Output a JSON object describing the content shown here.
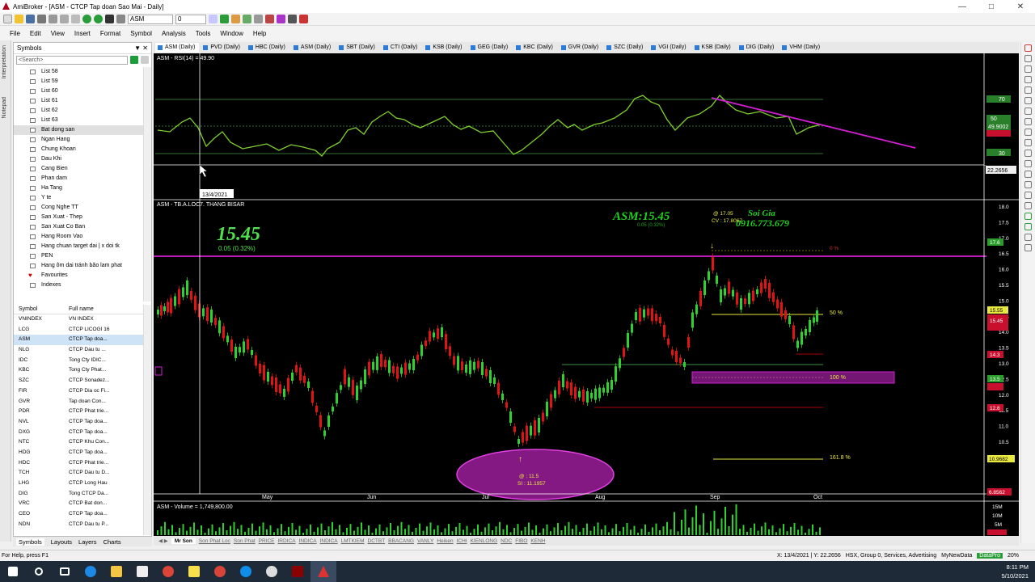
{
  "window": {
    "title": "AmiBroker - [ASM - CTCP Tap doan Sao Mai - Daily]"
  },
  "toolbar": {
    "symbol": "ASM",
    "value": "0"
  },
  "menu": [
    "File",
    "Edit",
    "View",
    "Insert",
    "Format",
    "Symbol",
    "Analysis",
    "Tools",
    "Window",
    "Help"
  ],
  "left_tabs": [
    "Interpretation",
    "Notepad"
  ],
  "symbols_panel": {
    "title": "Symbols",
    "search_placeholder": "<Search>",
    "tree": [
      {
        "label": "List 58"
      },
      {
        "label": "List 59"
      },
      {
        "label": "List 60"
      },
      {
        "label": "List 61"
      },
      {
        "label": "List 62"
      },
      {
        "label": "List 63"
      },
      {
        "label": "Bat dong san",
        "selected": true
      },
      {
        "label": "Ngan Hang"
      },
      {
        "label": "Chung Khoan"
      },
      {
        "label": "Dau Khi"
      },
      {
        "label": "Cang Bien"
      },
      {
        "label": "Phan dam"
      },
      {
        "label": "Ha Tang"
      },
      {
        "label": "Y te"
      },
      {
        "label": "Cong Nghe TT"
      },
      {
        "label": "San Xuat - Thep"
      },
      {
        "label": "San Xuat Co Ban"
      },
      {
        "label": "Hang Room Vao"
      },
      {
        "label": "Hang chuan target dai | x doi tk"
      },
      {
        "label": "PEN"
      },
      {
        "label": "Hang ôm dai tránh bão lam phat"
      },
      {
        "label": "Favourites",
        "heart": true
      },
      {
        "label": "Indexes"
      }
    ],
    "col_symbol": "Symbol",
    "col_fullname": "Full name",
    "rows": [
      {
        "s": "VNINDEX",
        "n": "VN INDEX"
      },
      {
        "s": "LCG",
        "n": "CTCP LICOGI 16"
      },
      {
        "s": "ASM",
        "n": "CTCP Tap doa...",
        "selected": true
      },
      {
        "s": "NLG",
        "n": "CTCP Dau tu ..."
      },
      {
        "s": "IDC",
        "n": "Tong Cty IDIC..."
      },
      {
        "s": "KBC",
        "n": "Tong Cty Phat..."
      },
      {
        "s": "SZC",
        "n": "CTCP Sonadez..."
      },
      {
        "s": "FIR",
        "n": "CTCP Dia oc Fi..."
      },
      {
        "s": "GVR",
        "n": "Tap  doan Con..."
      },
      {
        "s": "PDR",
        "n": "CTCP Phat trie..."
      },
      {
        "s": "NVL",
        "n": "CTCP Tap doa..."
      },
      {
        "s": "DXG",
        "n": "CTCP Tap doa..."
      },
      {
        "s": "NTC",
        "n": "CTCP Khu Con..."
      },
      {
        "s": "HDG",
        "n": "CTCP Tap doa..."
      },
      {
        "s": "HDC",
        "n": "CTCP Phat trie..."
      },
      {
        "s": "TCH",
        "n": "CTCP Dau tu D..."
      },
      {
        "s": "LHG",
        "n": "CTCP Long Hau"
      },
      {
        "s": "DIG",
        "n": "Tong CTCP Da..."
      },
      {
        "s": "VRC",
        "n": "CTCP Bat don..."
      },
      {
        "s": "CEO",
        "n": "CTCP Tap doa..."
      },
      {
        "s": "NDN",
        "n": "CTCP Dau tu P..."
      }
    ],
    "bottom_tabs": [
      "Symbols",
      "Layouts",
      "Layers",
      "Charts"
    ]
  },
  "chart_tabs": [
    "ASM (Daily)",
    "PVD (Daily)",
    "HBC (Daily)",
    "ASM (Daily)",
    "SBT (Daily)",
    "CTI (Daily)",
    "KSB (Daily)",
    "GEG (Daily)",
    "KBC (Daily)",
    "GVR (Daily)",
    "SZC (Daily)",
    "VGI (Daily)",
    "KSB (Daily)",
    "DIG (Daily)",
    "VHM (Daily)"
  ],
  "chart": {
    "rsi_label": "ASM - RSI(14) = 49.90",
    "rsi_value": "49.9002",
    "rsi_right": "22.2656",
    "rsi_ticks": [
      "70",
      "50",
      "30"
    ],
    "cursor_date": "13/4/2021",
    "price_label": "ASM - TB.A.LOC7. THANG BISAR",
    "price": "15.45",
    "change": "0.05  (0.32%)",
    "title_right": "ASM:15.45",
    "title_right_sub": "0.05 (0.32%)",
    "author": "Soi Gia",
    "phone": "0916.773.679",
    "high_note": "@ 17.05",
    "cv_note": "CV : 17.8067",
    "fib_0": "0 %",
    "fib_50": "50 %",
    "fib_100": "100 %",
    "fib_161": "161.8 %",
    "low_note1": "@ : 11.5",
    "low_note2": "SI : 11.1957",
    "months": [
      "May",
      "Jun",
      "Jul",
      "Aug",
      "Sep",
      "Oct"
    ],
    "price_ticks": [
      "18.0",
      "17.5",
      "17.0",
      "16.5",
      "16.0",
      "15.5",
      "15.0",
      "14.5",
      "14.0",
      "13.5",
      "13.0",
      "12.5",
      "12.0",
      "11.5",
      "11.0",
      "10.5"
    ],
    "price_badges": [
      "17.6",
      "15.55",
      "15.45",
      "14.3",
      "13.5",
      "12.6",
      "10.9682",
      "6.8562"
    ],
    "volume_label": "ASM - Volume = 1,749,800.00",
    "volume_ticks": [
      "15M",
      "10M",
      "5M"
    ]
  },
  "sheets": [
    "Mr Son",
    "Son Phat Loc",
    "Son Phat",
    "PRICE",
    "IRDICA",
    "INDICA",
    "INDICA",
    "LMTKIEM",
    "DCTBT",
    "BBACANG",
    "VANLY",
    "Heiken",
    "ICHI",
    "KIENLONG",
    "NDC",
    "FIBO",
    "KENH"
  ],
  "status": {
    "left": "For Help, press F1",
    "coords": "X: 13/4/2021 | Y: 22.2656",
    "group": "HSX, Group 0, Services, Advertising",
    "source": "MyNewData",
    "badge": "DataPro",
    "zoom": "20%"
  },
  "clock": {
    "time": "8:11 PM",
    "date": "5/10/2021"
  }
}
